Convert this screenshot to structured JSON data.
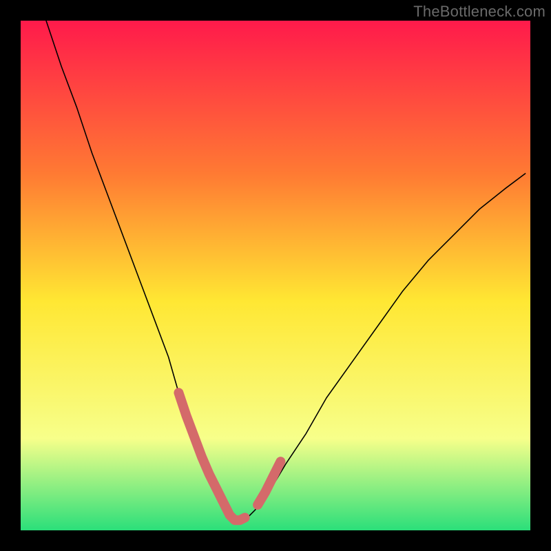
{
  "watermark": "TheBottleneck.com",
  "chart_data": {
    "type": "line",
    "title": "",
    "xlabel": "",
    "ylabel": "",
    "xlim": [
      0,
      100
    ],
    "ylim": [
      0,
      100
    ],
    "background_gradient": {
      "top": "#ff1a4b",
      "upper_mid": "#ff7a33",
      "mid": "#ffe733",
      "lower": "#f7ff8a",
      "bottom": "#2bdf7a"
    },
    "series": [
      {
        "name": "curve",
        "color": "#000000",
        "x": [
          5,
          8,
          11,
          14,
          17,
          20,
          23,
          26,
          29,
          31,
          33,
          35,
          37,
          39,
          40,
          41,
          42,
          44,
          46,
          49,
          52,
          56,
          60,
          65,
          70,
          75,
          80,
          85,
          90,
          95,
          99
        ],
        "y": [
          100,
          91,
          83,
          74,
          66,
          58,
          50,
          42,
          34,
          27,
          21,
          16,
          11,
          7,
          5,
          3,
          2,
          2,
          4,
          8,
          13,
          19,
          26,
          33,
          40,
          47,
          53,
          58,
          63,
          67,
          70
        ]
      }
    ],
    "highlight_segments": {
      "name": "optimal-zone",
      "color": "#d46a6a",
      "segments": [
        {
          "x": [
            31.0,
            32.5,
            34.0,
            35.5,
            37.0,
            38.5,
            40.0,
            41.0,
            42.0,
            43.0,
            44.0
          ],
          "y": [
            27.0,
            22.5,
            18.5,
            14.5,
            11.0,
            8.0,
            5.0,
            3.0,
            2.0,
            2.0,
            2.5
          ]
        },
        {
          "x": [
            46.5,
            48.0,
            49.5,
            51.0
          ],
          "y": [
            5.0,
            7.5,
            10.5,
            13.5
          ]
        }
      ]
    },
    "legend": null,
    "grid": false
  }
}
